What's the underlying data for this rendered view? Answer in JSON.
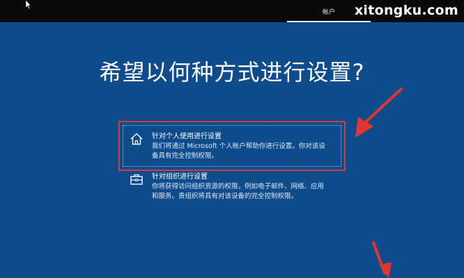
{
  "topbar": {
    "tab_label": "帐户",
    "watermark": "xitongku.com"
  },
  "page": {
    "title": "希望以何种方式进行设置?"
  },
  "options": [
    {
      "title": "针对个人使用进行设置",
      "desc_line1": "我们将通过 Microsoft 个人帐户帮助你进行设置。你对该设",
      "desc_line2": "备具有完全控制权限。",
      "icon": "home-icon"
    },
    {
      "title": "针对组织进行设置",
      "desc_line1": "你将获得访问组织资源的权限，例如电子邮件、网络、应用",
      "desc_line2": "和服务。贵组织将具有对该设备的完全控制权限。",
      "icon": "briefcase-icon"
    }
  ],
  "colors": {
    "background": "#0f4c8c",
    "topbar": "#0a0a0a",
    "annotation_red": "#d43a3a"
  }
}
